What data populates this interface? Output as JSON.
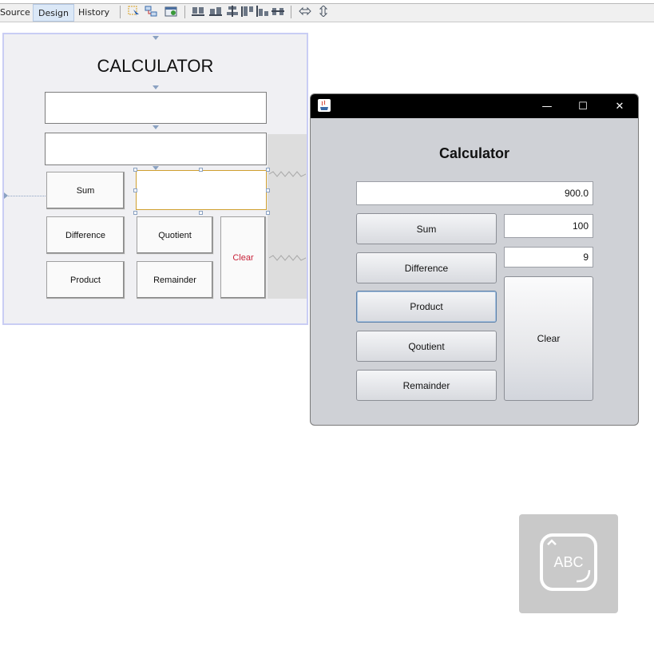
{
  "ide": {
    "tabs": [
      {
        "label": "Source"
      },
      {
        "label": "Design"
      },
      {
        "label": "History"
      }
    ],
    "toolbar_icons": [
      "selection-mode-icon",
      "connection-mode-icon",
      "preview-design-icon",
      "align-left-icon",
      "align-right-icon",
      "center-horizontal-icon",
      "align-top-icon",
      "align-bottom-icon",
      "center-vertical-icon",
      "resize-horizontal-icon",
      "resize-vertical-icon"
    ]
  },
  "design": {
    "title": "CALCULATOR",
    "buttons": {
      "sum": "Sum",
      "difference": "Difference",
      "quotient": "Quotient",
      "product": "Product",
      "remainder": "Remainder",
      "clear": "Clear"
    },
    "colors": {
      "clear_text": "#c8233a",
      "selection_border": "#c9cdf4"
    }
  },
  "window": {
    "controls": {
      "minimize": "—",
      "maximize": "☐",
      "close": "✕"
    },
    "title": "Calculator",
    "result": "900.0",
    "input1": "100",
    "input2": "9",
    "buttons": {
      "sum": "Sum",
      "difference": "Difference",
      "product": "Product",
      "qoutient": "Qoutient",
      "remainder": "Remainder",
      "clear": "Clear"
    }
  },
  "keyboard_widget": {
    "label": "ABC"
  }
}
